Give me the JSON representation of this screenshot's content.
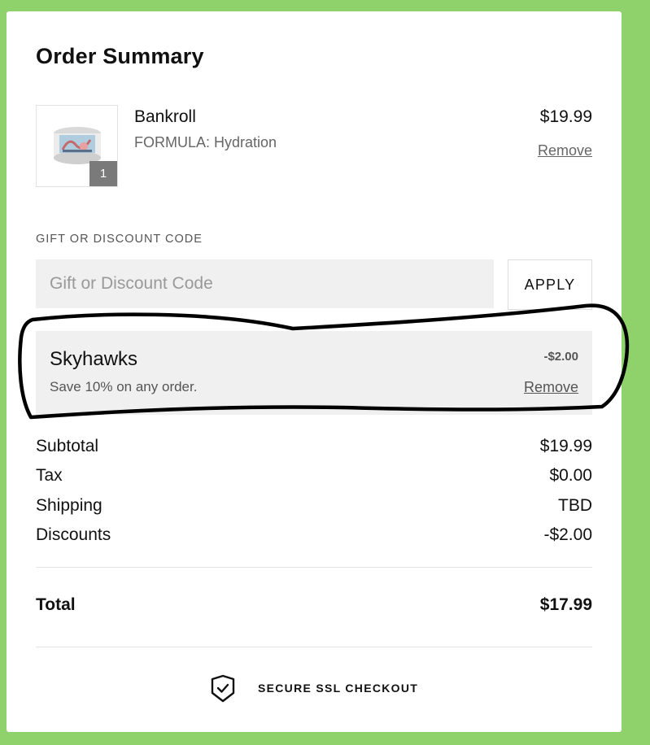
{
  "colors": {
    "page_background": "#8fd16a",
    "card_background": "#ffffff",
    "field_background": "#f0f0f0",
    "badge_background": "#7a7a7a",
    "scribble": "#000000"
  },
  "summary": {
    "title": "Order Summary"
  },
  "cart_item": {
    "name": "Bankroll",
    "option": "FORMULA: Hydration",
    "price": "$19.99",
    "quantity": "1",
    "remove_label": "Remove",
    "image_icon": "product-jar-icon"
  },
  "discount": {
    "section_label": "GIFT OR DISCOUNT CODE",
    "input_value": "",
    "input_placeholder": "Gift or Discount Code",
    "apply_label": "APPLY"
  },
  "applied_code": {
    "name": "Skyhawks",
    "description": "Save 10% on any order.",
    "amount": "-$2.00",
    "remove_label": "Remove"
  },
  "totals": {
    "rows": [
      {
        "label": "Subtotal",
        "value": "$19.99"
      },
      {
        "label": "Tax",
        "value": "$0.00"
      },
      {
        "label": "Shipping",
        "value": "TBD"
      },
      {
        "label": "Discounts",
        "value": "-$2.00"
      }
    ],
    "total_label": "Total",
    "total_value": "$17.99"
  },
  "footer": {
    "secure_label": "SECURE SSL CHECKOUT",
    "secure_icon": "shield-check-icon"
  }
}
